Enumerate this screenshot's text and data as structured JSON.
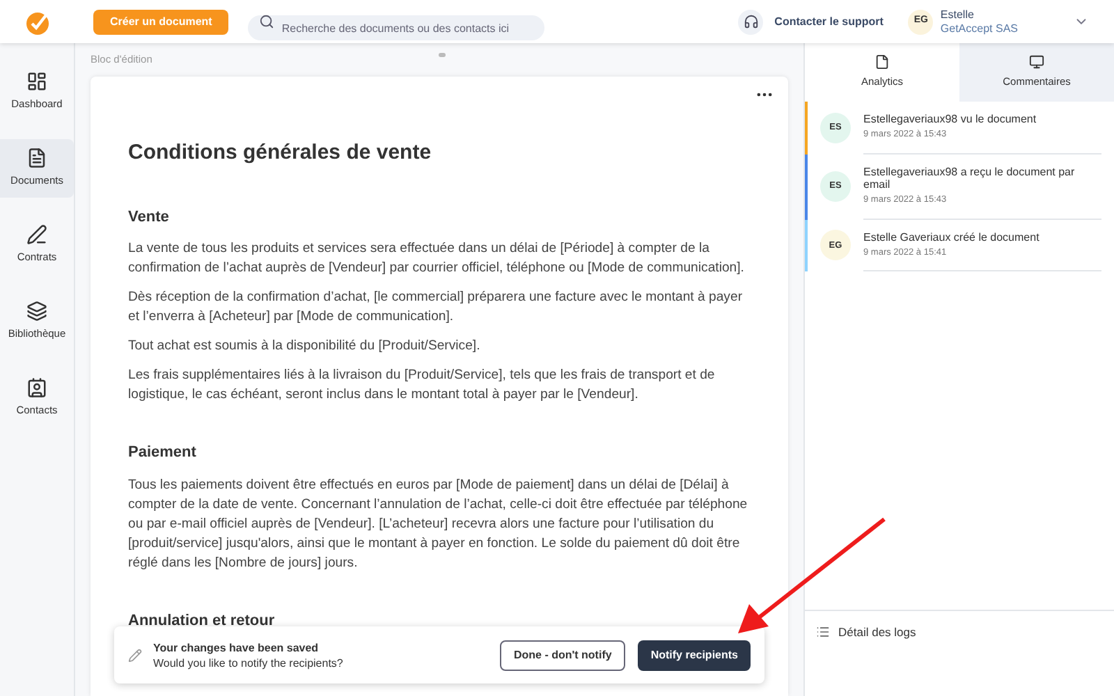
{
  "header": {
    "create_button": "Créer un document",
    "search": {
      "placeholder": "Recherche des documents ou des contacts ici"
    },
    "support": "Contacter le support",
    "user": {
      "initials": "EG",
      "name": "Estelle",
      "company": "GetAccept SAS"
    }
  },
  "sidebar": {
    "items": [
      {
        "label": "Dashboard",
        "selected": false
      },
      {
        "label": "Documents",
        "selected": true
      },
      {
        "label": "Contrats",
        "selected": false
      },
      {
        "label": "Bibliothèque",
        "selected": false
      },
      {
        "label": "Contacts",
        "selected": false
      }
    ]
  },
  "editor": {
    "breadcrumb": "Bloc d'édition",
    "title": "Conditions générales de vente",
    "sections": [
      {
        "heading": "Vente",
        "paragraphs": [
          "La vente de tous les produits et services sera effectuée dans un délai de [Période] à compter de la confirmation de l’achat auprès de [Vendeur] par courrier officiel, téléphone ou [Mode de communication].",
          "Dès réception de la confirmation d’achat, [le commercial] préparera une facture avec le montant à payer et l’enverra à [Acheteur] par [Mode de communication].",
          "Tout achat est soumis à la disponibilité du [Produit/Service].",
          "Les frais supplémentaires liés à la livraison du [Produit/Service], tels que les frais de transport et de logistique, le cas échéant, seront inclus dans le montant total à payer par le [Vendeur]."
        ]
      },
      {
        "heading": "Paiement",
        "paragraphs": [
          "Tous les paiements doivent être effectués en euros par [Mode de paiement] dans un délai de [Délai] à compter de la date de vente. Concernant l’annulation de l’achat, celle-ci doit être effectuée par téléphone ou par e-mail officiel auprès de [Vendeur]. [L’acheteur] recevra alors une facture pour l’utilisation du [produit/service] jusqu'alors, ainsi que le montant à payer en fonction. Le solde du paiement dû doit être réglé dans les [Nombre de jours] jours."
        ]
      },
      {
        "heading": "Annulation et retour"
      }
    ]
  },
  "toast": {
    "title": "Your changes have been saved",
    "message": "Would you like to notify the recipients?",
    "buttons": [
      {
        "label": "Done - don't notify",
        "kind": "secondary"
      },
      {
        "label": "Notify recipients",
        "kind": "primary"
      }
    ]
  },
  "panel": {
    "tabs": [
      {
        "label": "Analytics",
        "selected": true
      },
      {
        "label": "Commentaires",
        "selected": false
      }
    ],
    "activity": [
      {
        "initials": "ES",
        "text": "Estellegaveriaux98 vu le document",
        "time": "9 mars 2022 à 15:43",
        "color": "#f5a623"
      },
      {
        "initials": "ES",
        "text": "Estellegaveriaux98 a reçu le document par email",
        "time": "9 mars 2022 à 15:43",
        "color": "#4a86e8"
      },
      {
        "initials": "EG",
        "text": "Estelle Gaveriaux créé le document",
        "time": "9 mars 2022 à 15:41",
        "color": "#8fd3fe"
      }
    ],
    "logs": "Détail des logs"
  }
}
